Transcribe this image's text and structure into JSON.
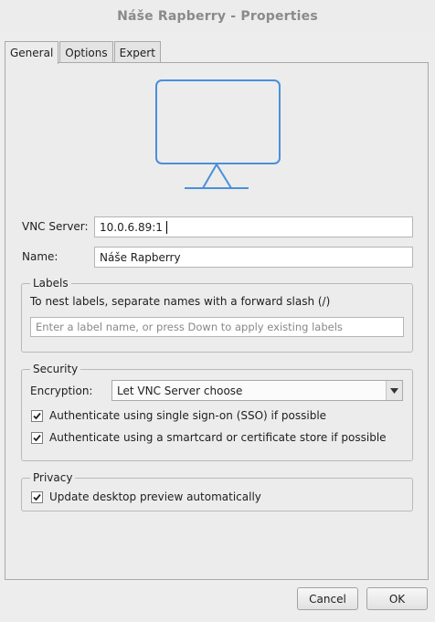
{
  "window": {
    "title": "Náše Rapberry - Properties"
  },
  "tabs": [
    {
      "label": "General",
      "active": true
    },
    {
      "label": "Options",
      "active": false
    },
    {
      "label": "Expert",
      "active": false
    }
  ],
  "general": {
    "monitor_icon": "monitor-icon",
    "vnc_server": {
      "label": "VNC Server:",
      "value": "10.0.6.89:1"
    },
    "name": {
      "label": "Name:",
      "value": "Náše Rapberry"
    },
    "labels": {
      "legend": "Labels",
      "hint": "To nest labels, separate names with a forward slash (/)",
      "placeholder": "Enter a label name, or press Down to apply existing labels"
    },
    "security": {
      "legend": "Security",
      "encryption_label": "Encryption:",
      "encryption_value": "Let VNC Server choose",
      "sso_label": "Authenticate using single sign-on (SSO) if possible",
      "sso_checked": true,
      "smartcard_label": "Authenticate using a smartcard or certificate store if possible",
      "smartcard_checked": true
    },
    "privacy": {
      "legend": "Privacy",
      "preview_label": "Update desktop preview automatically",
      "preview_checked": true
    }
  },
  "buttons": {
    "cancel": "Cancel",
    "ok": "OK"
  },
  "colors": {
    "icon": "#4a90d9",
    "window_bg": "#ececec"
  }
}
